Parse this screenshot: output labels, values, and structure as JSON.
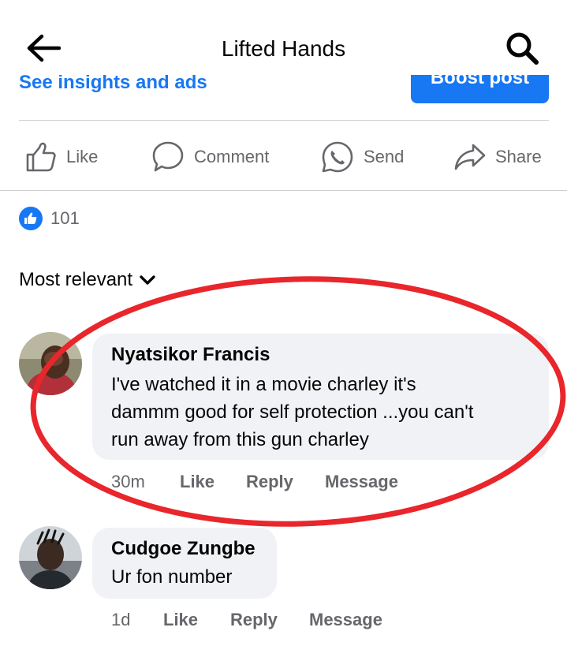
{
  "header": {
    "title": "Lifted Hands",
    "back_icon": "back-arrow-icon",
    "search_icon": "search-icon"
  },
  "peek": {
    "link_text": "See insights and ads",
    "button_label": "Boost post"
  },
  "actions": {
    "like": "Like",
    "comment": "Comment",
    "send": "Send",
    "share": "Share"
  },
  "reactions": {
    "count": "101",
    "icon": "like-reaction-icon"
  },
  "sort": {
    "label": "Most relevant"
  },
  "comments": [
    {
      "author": "Nyatsikor Francis",
      "lines": [
        "I've watched it in a movie charley  it's",
        "dammm good for self protection  ...you can't",
        "run away from this gun charley"
      ],
      "time": "30m",
      "like": "Like",
      "reply": "Reply",
      "message": "Message"
    },
    {
      "author": "Cudgoe Zungbe",
      "lines": [
        "Ur fon number"
      ],
      "time": "1d",
      "like": "Like",
      "reply": "Reply",
      "message": "Message"
    }
  ],
  "colors": {
    "accent": "#1877f2",
    "secondary_text": "#65676b",
    "bubble": "#f0f2f5",
    "annotation": "#e8262b"
  }
}
